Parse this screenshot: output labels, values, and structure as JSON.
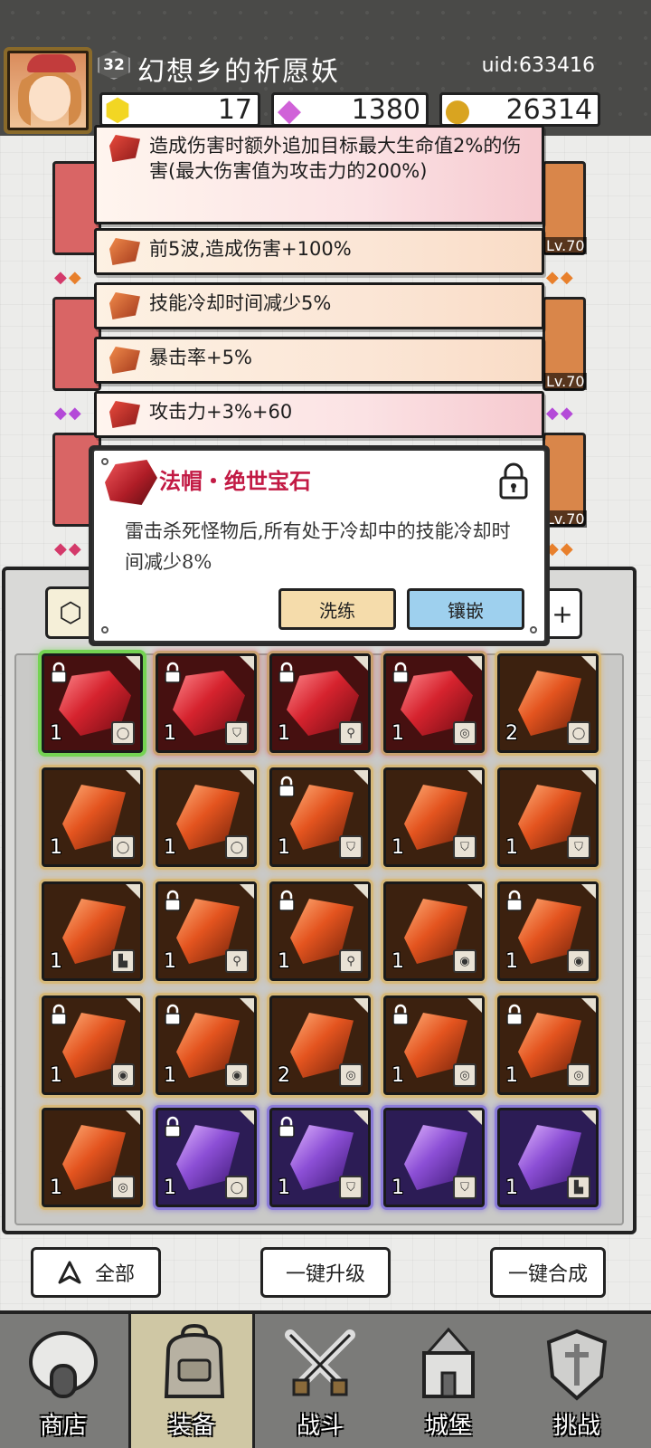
{
  "header": {
    "level": "32",
    "player_name": "幻想乡的祈愿妖",
    "uid": "uid:633416",
    "currencies": [
      {
        "name": "gold-gem",
        "value": "17",
        "icon": "yellow-gem-icon"
      },
      {
        "name": "diamond",
        "value": "1380",
        "icon": "purple-diamond-icon"
      },
      {
        "name": "coin",
        "value": "26314",
        "icon": "gold-coin-icon"
      }
    ]
  },
  "equipment_slots": {
    "right_levels": [
      "Lv.70",
      "Lv.70",
      "Lv.70"
    ]
  },
  "stats": [
    {
      "text": "造成伤害时额外追加目标最大生命值2%的伤害(最大伤害值为攻击力的200%)",
      "style": "red"
    },
    {
      "text": "前5波,造成伤害+100%",
      "style": "orange"
    },
    {
      "text": "技能冷却时间减少5%",
      "style": "orange"
    },
    {
      "text": "暴击率+5%",
      "style": "orange"
    },
    {
      "text": "攻击力+3%+60",
      "style": "red"
    }
  ],
  "gem_dialog": {
    "title": "法帽・绝世宝石",
    "description": "雷击杀死怪物后,所有处于冷却中的技能冷却时间减少8%",
    "refine_label": "洗练",
    "inlay_label": "镶嵌"
  },
  "inventory": {
    "plus_label": "+",
    "gems": [
      {
        "rarity": "red",
        "count": "1",
        "locked": true,
        "slot": "ring",
        "selected": true
      },
      {
        "rarity": "red",
        "count": "1",
        "locked": true,
        "slot": "armor",
        "selected": false
      },
      {
        "rarity": "red",
        "count": "1",
        "locked": true,
        "slot": "staff",
        "selected": false
      },
      {
        "rarity": "red",
        "count": "1",
        "locked": true,
        "slot": "amulet",
        "selected": false
      },
      {
        "rarity": "orange",
        "count": "2",
        "locked": false,
        "slot": "ring",
        "selected": false
      },
      {
        "rarity": "orange",
        "count": "1",
        "locked": false,
        "slot": "ring",
        "selected": false
      },
      {
        "rarity": "orange",
        "count": "1",
        "locked": false,
        "slot": "ring",
        "selected": false
      },
      {
        "rarity": "orange",
        "count": "1",
        "locked": true,
        "slot": "armor",
        "selected": false
      },
      {
        "rarity": "orange",
        "count": "1",
        "locked": false,
        "slot": "armor",
        "selected": false
      },
      {
        "rarity": "orange",
        "count": "1",
        "locked": false,
        "slot": "armor",
        "selected": false
      },
      {
        "rarity": "orange",
        "count": "1",
        "locked": false,
        "slot": "boots",
        "selected": false
      },
      {
        "rarity": "orange",
        "count": "1",
        "locked": true,
        "slot": "staff",
        "selected": false
      },
      {
        "rarity": "orange",
        "count": "1",
        "locked": true,
        "slot": "staff",
        "selected": false
      },
      {
        "rarity": "orange",
        "count": "1",
        "locked": false,
        "slot": "ring2",
        "selected": false
      },
      {
        "rarity": "orange",
        "count": "1",
        "locked": true,
        "slot": "ring2",
        "selected": false
      },
      {
        "rarity": "orange",
        "count": "1",
        "locked": true,
        "slot": "ring2",
        "selected": false
      },
      {
        "rarity": "orange",
        "count": "1",
        "locked": true,
        "slot": "ring2",
        "selected": false
      },
      {
        "rarity": "orange",
        "count": "2",
        "locked": false,
        "slot": "amulet",
        "selected": false
      },
      {
        "rarity": "orange",
        "count": "1",
        "locked": true,
        "slot": "amulet",
        "selected": false
      },
      {
        "rarity": "orange",
        "count": "1",
        "locked": true,
        "slot": "amulet",
        "selected": false
      },
      {
        "rarity": "orange",
        "count": "1",
        "locked": false,
        "slot": "amulet",
        "selected": false
      },
      {
        "rarity": "purple",
        "count": "1",
        "locked": true,
        "slot": "ring",
        "selected": false
      },
      {
        "rarity": "purple",
        "count": "1",
        "locked": true,
        "slot": "armor",
        "selected": false
      },
      {
        "rarity": "purple",
        "count": "1",
        "locked": false,
        "slot": "armor",
        "selected": false
      },
      {
        "rarity": "purple",
        "count": "1",
        "locked": false,
        "slot": "boots",
        "selected": false
      }
    ]
  },
  "actions": {
    "all_label": "全部",
    "upgrade_label": "一键升级",
    "merge_label": "一键合成"
  },
  "tabs": [
    {
      "label": "商店",
      "icon": "shop-icon",
      "active": false
    },
    {
      "label": "装备",
      "icon": "backpack-icon",
      "active": true
    },
    {
      "label": "战斗",
      "icon": "crossed-swords-icon",
      "active": false
    },
    {
      "label": "城堡",
      "icon": "castle-icon",
      "active": false
    },
    {
      "label": "挑战",
      "icon": "shield-crest-icon",
      "active": false
    }
  ]
}
